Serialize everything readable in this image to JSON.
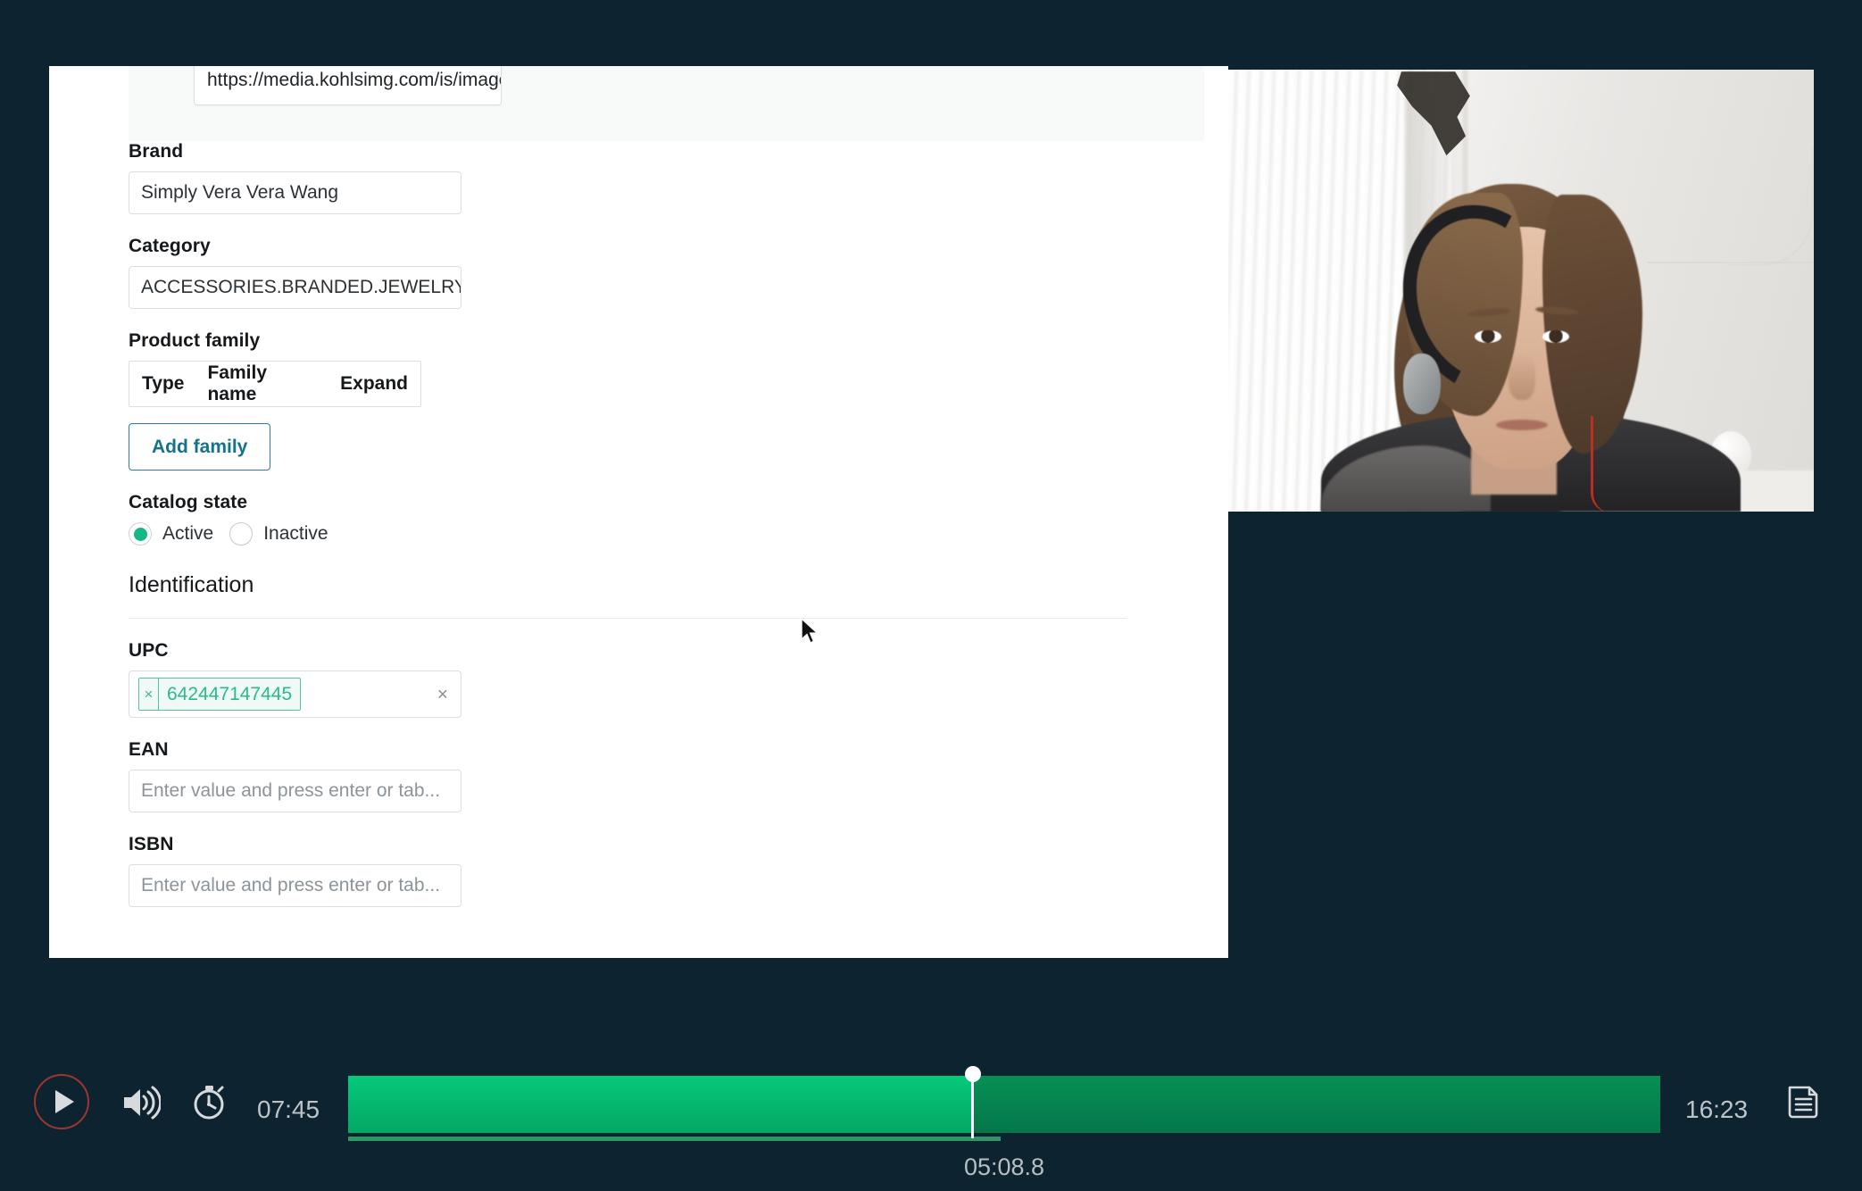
{
  "capture": {
    "image_url_field": {
      "value": "https://media.kohlsimg.com/is/image/k",
      "name": "image-url"
    },
    "fields": [
      {
        "label": "Brand",
        "value": "Simply Vera Vera Wang",
        "placeholder": ""
      },
      {
        "label": "Category",
        "value": "ACCESSORIES.BRANDED.JEWELRY.VERA",
        "placeholder": ""
      }
    ],
    "product_family": {
      "label": "Product family",
      "columns": [
        "Type",
        "Family name",
        "Expand"
      ],
      "rows": [],
      "add_button_label": "Add family"
    },
    "catalog_state": {
      "label": "Catalog state",
      "options": [
        {
          "label": "Active",
          "selected": true
        },
        {
          "label": "Inactive",
          "selected": false
        }
      ],
      "selected_color": "#17b885"
    },
    "identification": {
      "heading": "Identification",
      "upc": {
        "label": "UPC",
        "tags": [
          "642447147445"
        ],
        "tag_remove_glyph": "×",
        "clear_glyph": "×"
      },
      "ean": {
        "label": "EAN",
        "value": "",
        "placeholder": "Enter value and press enter or tab..."
      },
      "isbn": {
        "label": "ISBN",
        "value": "",
        "placeholder": "Enter value and press enter or tab..."
      }
    }
  },
  "player": {
    "play_button": "play-icon",
    "volume_button": "volume-icon",
    "speed_button": "stopwatch-icon",
    "transcript_button": "transcript-icon",
    "current_time": "07:45",
    "total_time": "16:23",
    "playhead_time": "05:08.8",
    "progress_percent": 47.5,
    "colors": {
      "played": "#05c97a",
      "remaining": "#068f55",
      "play_ring": "#9e3630",
      "background": "#0d2330"
    }
  }
}
